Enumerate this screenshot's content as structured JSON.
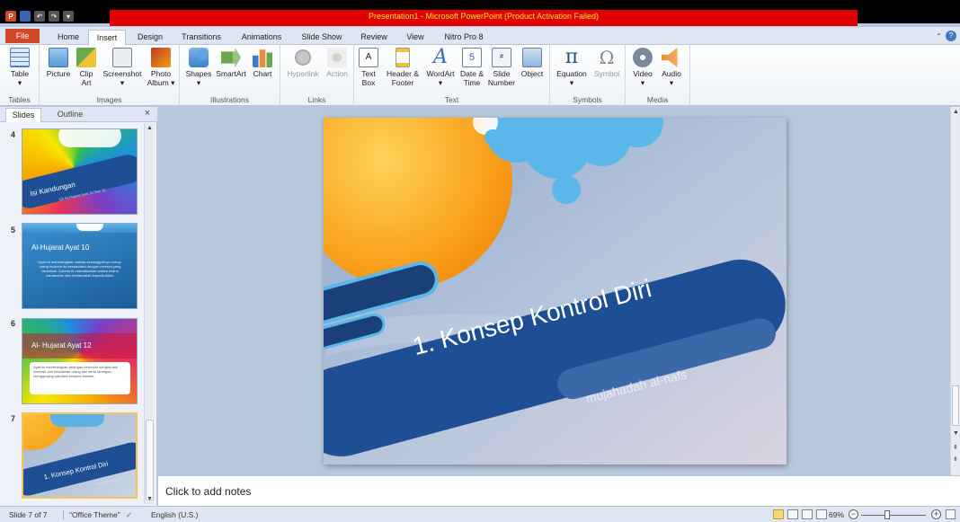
{
  "window": {
    "title": "Presentation1 - Microsoft PowerPoint (Product Activation Failed)"
  },
  "tabs": [
    {
      "label": "File"
    },
    {
      "label": "Home"
    },
    {
      "label": "Insert"
    },
    {
      "label": "Design"
    },
    {
      "label": "Transitions"
    },
    {
      "label": "Animations"
    },
    {
      "label": "Slide Show"
    },
    {
      "label": "Review"
    },
    {
      "label": "View"
    },
    {
      "label": "Nitro Pro 8"
    }
  ],
  "ribbon": {
    "groups": {
      "tables": "Tables",
      "images": "Images",
      "illustrations": "Illustrations",
      "links": "Links",
      "text": "Text",
      "symbols": "Symbols",
      "media": "Media"
    },
    "buttons": {
      "table": "Table",
      "picture": "Picture",
      "clip_art": "Clip Art",
      "screenshot": "Screenshot",
      "photo_album": "Photo Album",
      "shapes": "Shapes",
      "smartart": "SmartArt",
      "chart": "Chart",
      "hyperlink": "Hyperlink",
      "action": "Action",
      "text_box": "Text Box",
      "header_footer": "Header & Footer",
      "wordart": "WordArt",
      "date_time": "Date & Time",
      "slide_number": "Slide Number",
      "object": "Object",
      "equation": "Equation",
      "symbol": "Symbol",
      "video": "Video",
      "audio": "Audio"
    }
  },
  "panel": {
    "tab_slides": "Slides",
    "tab_outline": "Outline",
    "close": "×"
  },
  "thumbnails": [
    {
      "num": "4",
      "title": "Isi Kandungan",
      "sub": "QS Al-Hujurat Ayat 10 Dan 12"
    },
    {
      "num": "5",
      "title": "Al-Hujarat Ayat 10",
      "body": "Ayat ini menerangkan, bahwa sesungguhnya orang-orang mukmin itu bersaudara dengan mereka yang berselisih. Karena itu damaikanlah antara kedua saudaramu dan bertakwalah kepada Allah."
    },
    {
      "num": "6",
      "title": "Al- Hujarat Ayat 12",
      "body": "Ayat ini menerangkan larangan berburuk sangka dan mencari-cari kesalahan orang lain serta larangan menggunjing saudara sesama muslim."
    },
    {
      "num": "7",
      "title": "1. Konsep Kontrol Diri",
      "sub": "mujahadah al-nafs"
    }
  ],
  "slide": {
    "title": "1. Konsep Kontrol Diri",
    "subtitle": "mujahadah al-nafs"
  },
  "notes": {
    "placeholder": "Click to add notes"
  },
  "status": {
    "slide": "Slide 7 of 7",
    "theme": "\"Office Theme\"",
    "language": "English (U.S.)",
    "zoom": "69%",
    "zoom_value": 0.69
  },
  "colors": {
    "titlebar_warning": "#e00000",
    "file_tab": "#d24726",
    "slide_band": "#1e4f94",
    "selection": "#f2c45a"
  }
}
